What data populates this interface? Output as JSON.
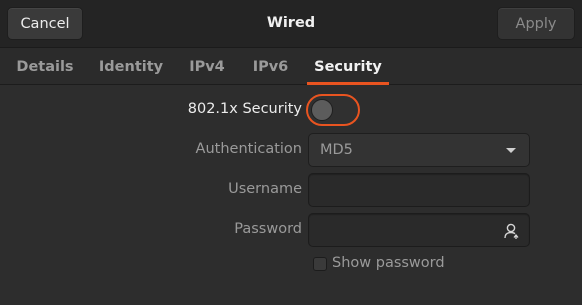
{
  "header": {
    "cancel_label": "Cancel",
    "title": "Wired",
    "apply_label": "Apply"
  },
  "tabs": [
    {
      "label": "Details",
      "active": false
    },
    {
      "label": "Identity",
      "active": false
    },
    {
      "label": "IPv4",
      "active": false
    },
    {
      "label": "IPv6",
      "active": false
    },
    {
      "label": "Security",
      "active": true
    }
  ],
  "security": {
    "toggle_label": "802.1x Security",
    "toggle_on": false,
    "authentication_label": "Authentication",
    "authentication_value": "MD5",
    "username_label": "Username",
    "username_value": "",
    "password_label": "Password",
    "password_value": "",
    "show_password_label": "Show password",
    "show_password_checked": false
  },
  "colors": {
    "accent": "#e95420",
    "background": "#2d2d2d",
    "header_background": "#242424"
  }
}
